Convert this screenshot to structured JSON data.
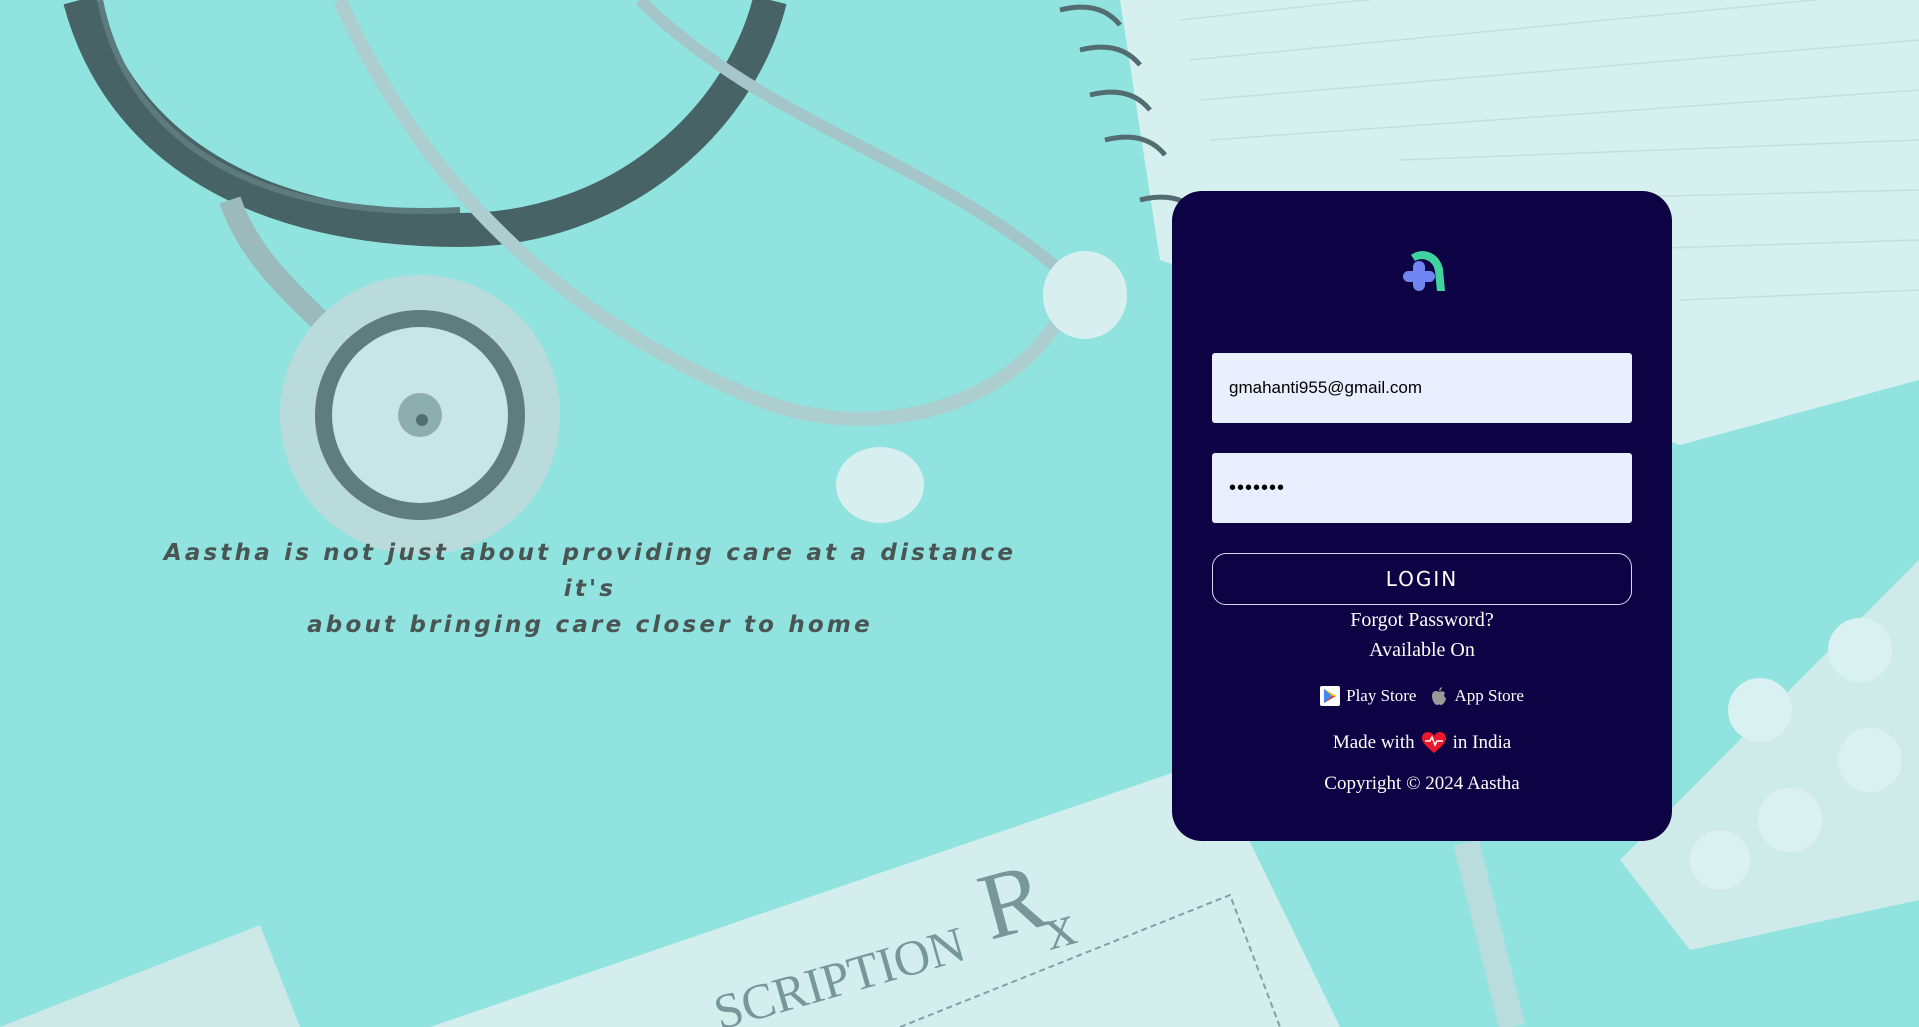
{
  "background": {
    "rx_symbol": "Rx",
    "prescription_text": "SCRIPTION"
  },
  "tagline": {
    "line1": "Aastha is not just about providing care at a distance it's",
    "line2": "about bringing care closer to home"
  },
  "login_card": {
    "logo_icon": "aastha-logo-icon",
    "email_value": "gmahanti955@gmail.com",
    "password_value": "•••••••",
    "login_label": "LOGIN",
    "forgot_label": "Forgot Password?",
    "available_label": "Available On",
    "stores": [
      {
        "label": "Play Store",
        "icon": "play-store-icon"
      },
      {
        "label": "App Store",
        "icon": "apple-icon"
      }
    ],
    "made_prefix": "Made with",
    "made_suffix": "in India",
    "copyright": "Copyright © 2024 Aastha"
  },
  "colors": {
    "card_bg": "#0c0244",
    "page_bg": "#8fe3df",
    "input_bg": "#e9efff",
    "logo_green": "#3fd3a0",
    "logo_blue": "#6f86f0",
    "heart": "#e8192c"
  }
}
